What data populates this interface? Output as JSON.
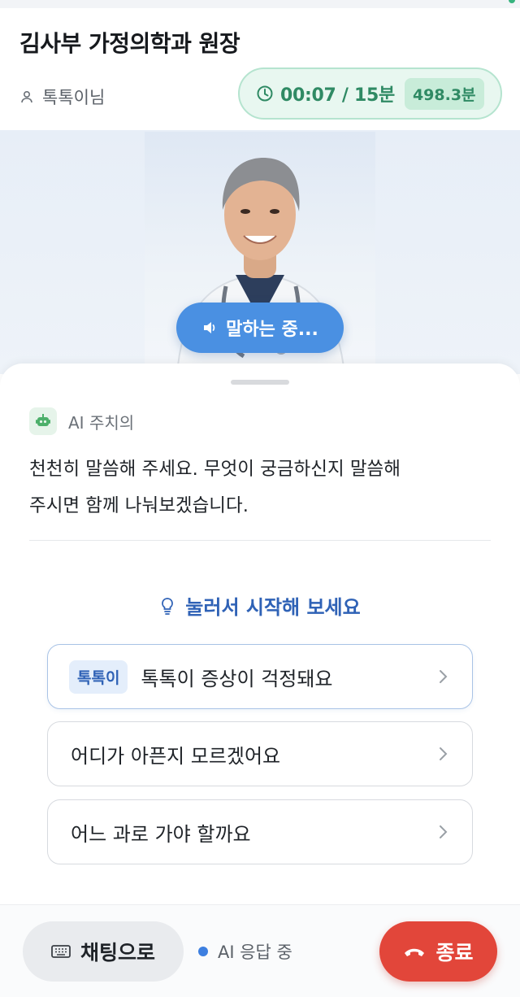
{
  "header": {
    "title": "김사부 가정의학과 원장",
    "user_name": "톡톡이님",
    "timer": "00:07 / 15분",
    "remaining_badge": "498.3분"
  },
  "stage": {
    "speaking_label": "말하는 중..."
  },
  "assistant": {
    "label": "AI 주치의",
    "message_line1": "천천히 말씀해 주세요. 무엇이 궁금하신지 말씀해",
    "message_line2": "주시면 함께 나눠보겠습니다."
  },
  "suggestions": {
    "hint": "눌러서 시작해 보세요",
    "items": [
      {
        "tag": "톡톡이",
        "label": "톡톡이 증상이 걱정돼요"
      },
      {
        "label": "어디가 아픈지 모르겠어요"
      },
      {
        "label": "어느 과로 가야 할까요"
      }
    ]
  },
  "bottom": {
    "chat_button": "채팅으로",
    "status": "AI 응답 중",
    "end_button": "종료"
  },
  "colors": {
    "accent_green": "#2f8a64",
    "accent_blue": "#4a90e2",
    "end_red": "#e2463a"
  },
  "icons": [
    "user-icon",
    "clock-icon",
    "speaker-icon",
    "robot-icon",
    "lightbulb-icon",
    "chevron-right-icon",
    "keyboard-icon",
    "phone-hangup-icon"
  ]
}
